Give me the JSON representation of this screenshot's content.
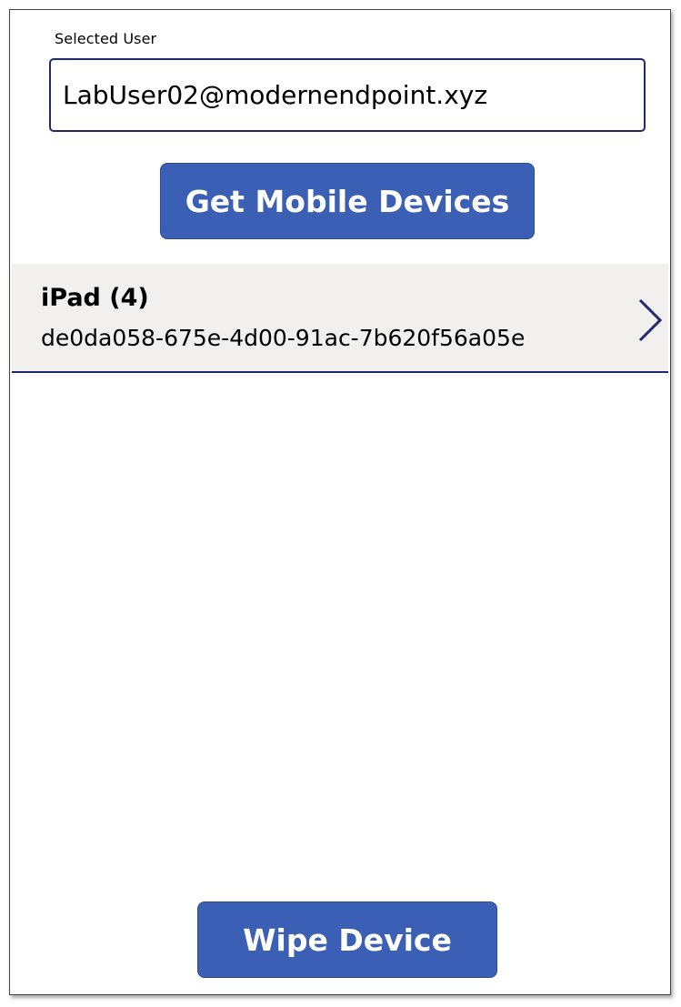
{
  "form": {
    "selected_user_label": "Selected User",
    "selected_user_value": "LabUser02@modernendpoint.xyz"
  },
  "actions": {
    "get_devices_label": "Get Mobile Devices",
    "wipe_device_label": "Wipe Device"
  },
  "devices": [
    {
      "name": "iPad (4)",
      "id": "de0da058-675e-4d00-91ac-7b620f56a05e",
      "icon": "chevron-right-icon"
    }
  ],
  "colors": {
    "button_bg": "#3a5fb4",
    "accent_border": "#1e2a6b",
    "row_bg": "#f1f0ef"
  }
}
